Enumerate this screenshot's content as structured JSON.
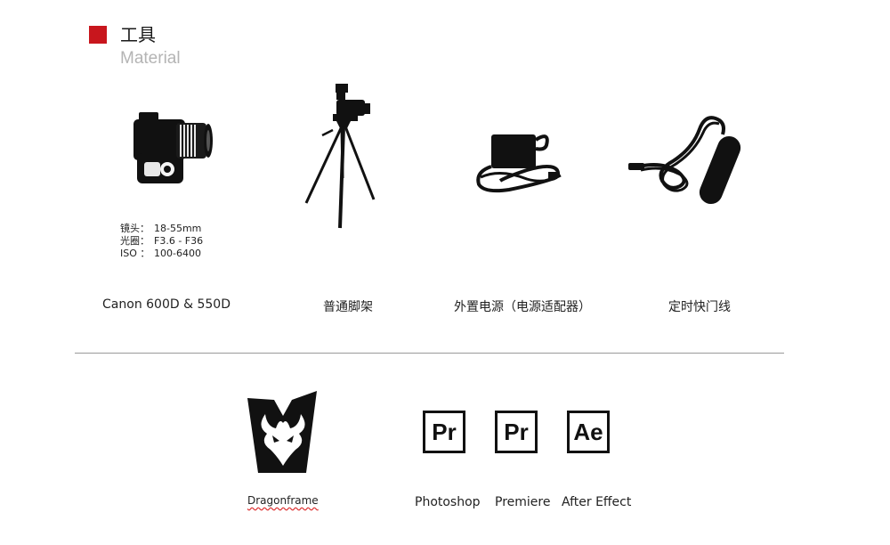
{
  "header": {
    "title_cn": "工具",
    "title_en": "Material",
    "accent_color": "#c8161d"
  },
  "camera": {
    "specs": [
      {
        "label": "镜头：",
        "value": "18-55mm"
      },
      {
        "label": "光圈：",
        "value": "F3.6 - F36"
      },
      {
        "label": "ISO ：",
        "value": "100-6400"
      }
    ]
  },
  "equipment": [
    {
      "icon": "camera-icon",
      "caption": "Canon 600D  &  550D"
    },
    {
      "icon": "tripod-icon",
      "caption": "普通脚架"
    },
    {
      "icon": "power-adapter-icon",
      "caption": "外置电源（电源适配器）"
    },
    {
      "icon": "shutter-release-cable-icon",
      "caption": "定时快门线"
    }
  ],
  "software": {
    "dragonframe_label": "Dragonframe",
    "dragonframe_icon": "dragonframe-logo-icon",
    "apps": [
      {
        "glyph": "Pr",
        "label": "Photoshop",
        "icon": "premiere-logo-icon"
      },
      {
        "glyph": "Pr",
        "label": "Premiere",
        "icon": "premiere-logo-icon"
      },
      {
        "glyph": "Ae",
        "label": "After Effect",
        "icon": "after-effects-logo-icon"
      }
    ]
  }
}
